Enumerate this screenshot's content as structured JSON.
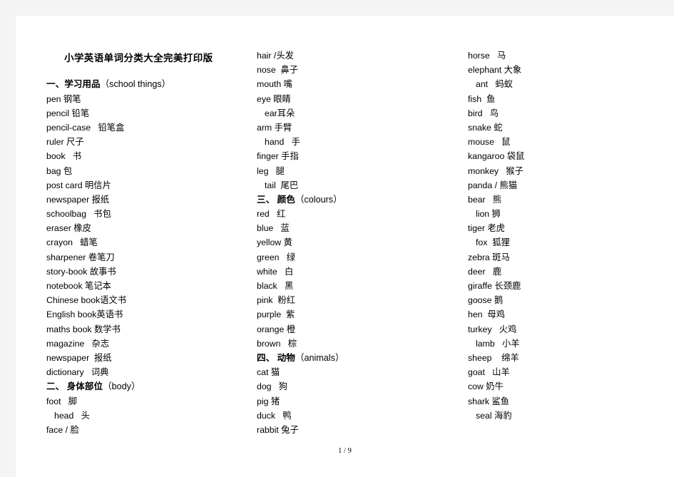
{
  "document": {
    "title": "小学英语单词分类大全完美打印版",
    "footer": "1 / 9"
  },
  "columns": [
    {
      "id": "column-1",
      "entries": [
        {
          "text": "",
          "style": "spacer"
        },
        {
          "text": "",
          "style": "spacer"
        },
        {
          "text": "一、学习用品（school things）",
          "style": "heading"
        },
        {
          "text": "pen 钢笔",
          "style": "normal"
        },
        {
          "text": "pencil 铅笔",
          "style": "normal"
        },
        {
          "text": "pencil-case   铅笔盒",
          "style": "normal"
        },
        {
          "text": "ruler 尺子",
          "style": "normal"
        },
        {
          "text": "book   书",
          "style": "normal"
        },
        {
          "text": "bag 包",
          "style": "normal"
        },
        {
          "text": "post card 明信片",
          "style": "normal"
        },
        {
          "text": "newspaper 报纸",
          "style": "normal"
        },
        {
          "text": "schoolbag   书包",
          "style": "normal"
        },
        {
          "text": "eraser 橡皮",
          "style": "normal"
        },
        {
          "text": "crayon   蜡笔",
          "style": "normal"
        },
        {
          "text": "sharpener 卷笔刀",
          "style": "normal"
        },
        {
          "text": "story-book 故事书",
          "style": "normal"
        },
        {
          "text": "notebook 笔记本",
          "style": "normal"
        },
        {
          "text": "Chinese book语文书",
          "style": "normal"
        },
        {
          "text": "English book英语书",
          "style": "normal"
        },
        {
          "text": "maths book 数学书",
          "style": "normal"
        },
        {
          "text": "magazine   杂志",
          "style": "normal"
        },
        {
          "text": "newspaper  报纸",
          "style": "normal"
        },
        {
          "text": "dictionary   词典",
          "style": "normal"
        },
        {
          "text": "二、 身体部位（body）",
          "style": "heading"
        },
        {
          "text": "foot   脚",
          "style": "normal"
        },
        {
          "text": "head   头",
          "style": "indent"
        },
        {
          "text": "face / 脸",
          "style": "normal"
        }
      ]
    },
    {
      "id": "column-2",
      "entries": [
        {
          "text": "hair /头发",
          "style": "normal"
        },
        {
          "text": "nose  鼻子",
          "style": "normal"
        },
        {
          "text": "mouth 嘴",
          "style": "normal"
        },
        {
          "text": "eye 眼睛",
          "style": "normal"
        },
        {
          "text": "ear耳朵",
          "style": "indent"
        },
        {
          "text": "arm 手臂",
          "style": "normal"
        },
        {
          "text": "hand   手",
          "style": "indent"
        },
        {
          "text": "finger 手指",
          "style": "normal"
        },
        {
          "text": "leg   腿",
          "style": "normal"
        },
        {
          "text": "tail  尾巴",
          "style": "indent"
        },
        {
          "text": "三、 颜色（colours）",
          "style": "heading"
        },
        {
          "text": "red   红",
          "style": "normal"
        },
        {
          "text": "blue   蓝",
          "style": "normal"
        },
        {
          "text": "yellow 黄",
          "style": "normal"
        },
        {
          "text": "green   绿",
          "style": "normal"
        },
        {
          "text": "white   白",
          "style": "normal"
        },
        {
          "text": "black   黑",
          "style": "normal"
        },
        {
          "text": "pink  粉红",
          "style": "normal"
        },
        {
          "text": "purple  紫",
          "style": "normal"
        },
        {
          "text": "orange 橙",
          "style": "normal"
        },
        {
          "text": "brown   棕",
          "style": "normal"
        },
        {
          "text": "四、 动物（animals）",
          "style": "heading"
        },
        {
          "text": "cat 猫",
          "style": "normal"
        },
        {
          "text": "dog   狗",
          "style": "normal"
        },
        {
          "text": "pig 猪",
          "style": "normal"
        },
        {
          "text": "duck   鸭",
          "style": "normal"
        },
        {
          "text": "rabbit 兔子",
          "style": "normal"
        }
      ]
    },
    {
      "id": "column-3",
      "entries": [
        {
          "text": "horse   马",
          "style": "normal"
        },
        {
          "text": "elephant 大象",
          "style": "normal"
        },
        {
          "text": "ant   蚂蚁",
          "style": "indent"
        },
        {
          "text": "fish  鱼",
          "style": "normal"
        },
        {
          "text": "bird   鸟",
          "style": "normal"
        },
        {
          "text": "snake 蛇",
          "style": "normal"
        },
        {
          "text": "mouse   鼠",
          "style": "normal"
        },
        {
          "text": "kangaroo 袋鼠",
          "style": "normal"
        },
        {
          "text": "monkey   猴子",
          "style": "normal"
        },
        {
          "text": "panda / 熊猫",
          "style": "normal"
        },
        {
          "text": "bear   熊",
          "style": "normal"
        },
        {
          "text": "lion 狮",
          "style": "indent"
        },
        {
          "text": "tiger 老虎",
          "style": "normal"
        },
        {
          "text": "fox  狐狸",
          "style": "indent"
        },
        {
          "text": "zebra 斑马",
          "style": "normal"
        },
        {
          "text": "deer   鹿",
          "style": "normal"
        },
        {
          "text": "giraffe 长颈鹿",
          "style": "normal"
        },
        {
          "text": "goose 鹅",
          "style": "normal"
        },
        {
          "text": "hen  母鸡",
          "style": "normal"
        },
        {
          "text": "turkey   火鸡",
          "style": "normal"
        },
        {
          "text": "lamb   小羊",
          "style": "indent"
        },
        {
          "text": "sheep    绵羊",
          "style": "normal"
        },
        {
          "text": "goat   山羊",
          "style": "normal"
        },
        {
          "text": "cow 奶牛",
          "style": "normal"
        },
        {
          "text": "shark 鲨鱼",
          "style": "normal"
        },
        {
          "text": "seal 海豹",
          "style": "indent"
        }
      ]
    }
  ]
}
